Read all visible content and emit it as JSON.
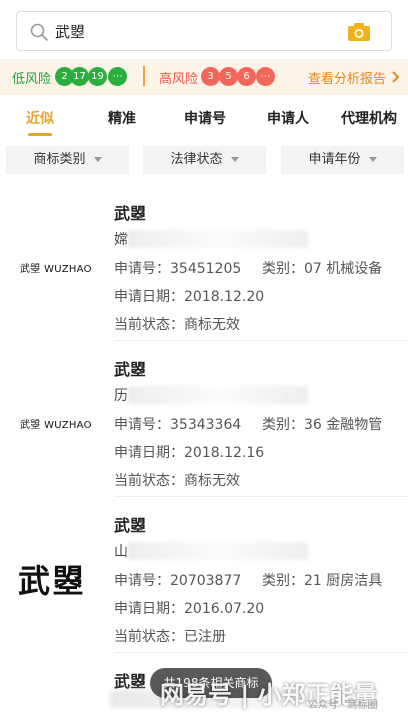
{
  "search": {
    "query": "武曌"
  },
  "risk": {
    "low_label": "低风险",
    "low_counts": [
      "2",
      "17",
      "19",
      "⋯"
    ],
    "high_label": "高风险",
    "high_counts": [
      "3",
      "5",
      "6",
      "⋯"
    ],
    "report_label": "查看分析报告"
  },
  "tabs": [
    "近似",
    "精准",
    "申请号",
    "申请人",
    "代理机构"
  ],
  "filters": [
    "商标类别",
    "法律状态",
    "申请年份"
  ],
  "results": [
    {
      "logo": "武曌 WUZHAO",
      "name": "武曌",
      "owner": "嫦",
      "owner_tail": "有限公司",
      "app_no": "申请号：35451205",
      "category": "类别：07 机械设备",
      "app_date": "申请日期：2018.12.20",
      "status": "当前状态：商标无效"
    },
    {
      "logo": "武曌 WUZHAO",
      "name": "武曌",
      "owner": "历",
      "owner_tail": "",
      "app_no": "申请号：35343364",
      "category": "类别：36 金融物管",
      "app_date": "申请日期：2018.12.16",
      "status": "当前状态：商标无效"
    },
    {
      "logo": "武曌",
      "name": "武曌",
      "owner": "山",
      "owner_tail": "限公司",
      "app_no": "申请号：20703877",
      "category": "类别：21 厨房洁具",
      "app_date": "申请日期：2016.07.20",
      "status": "当前状态：已注册"
    },
    {
      "name": "武曌"
    }
  ],
  "toast": "共198条相关商标",
  "watermark": "网易号 | 小郑正能量",
  "watermark_small": "公众号 · 商标圈"
}
